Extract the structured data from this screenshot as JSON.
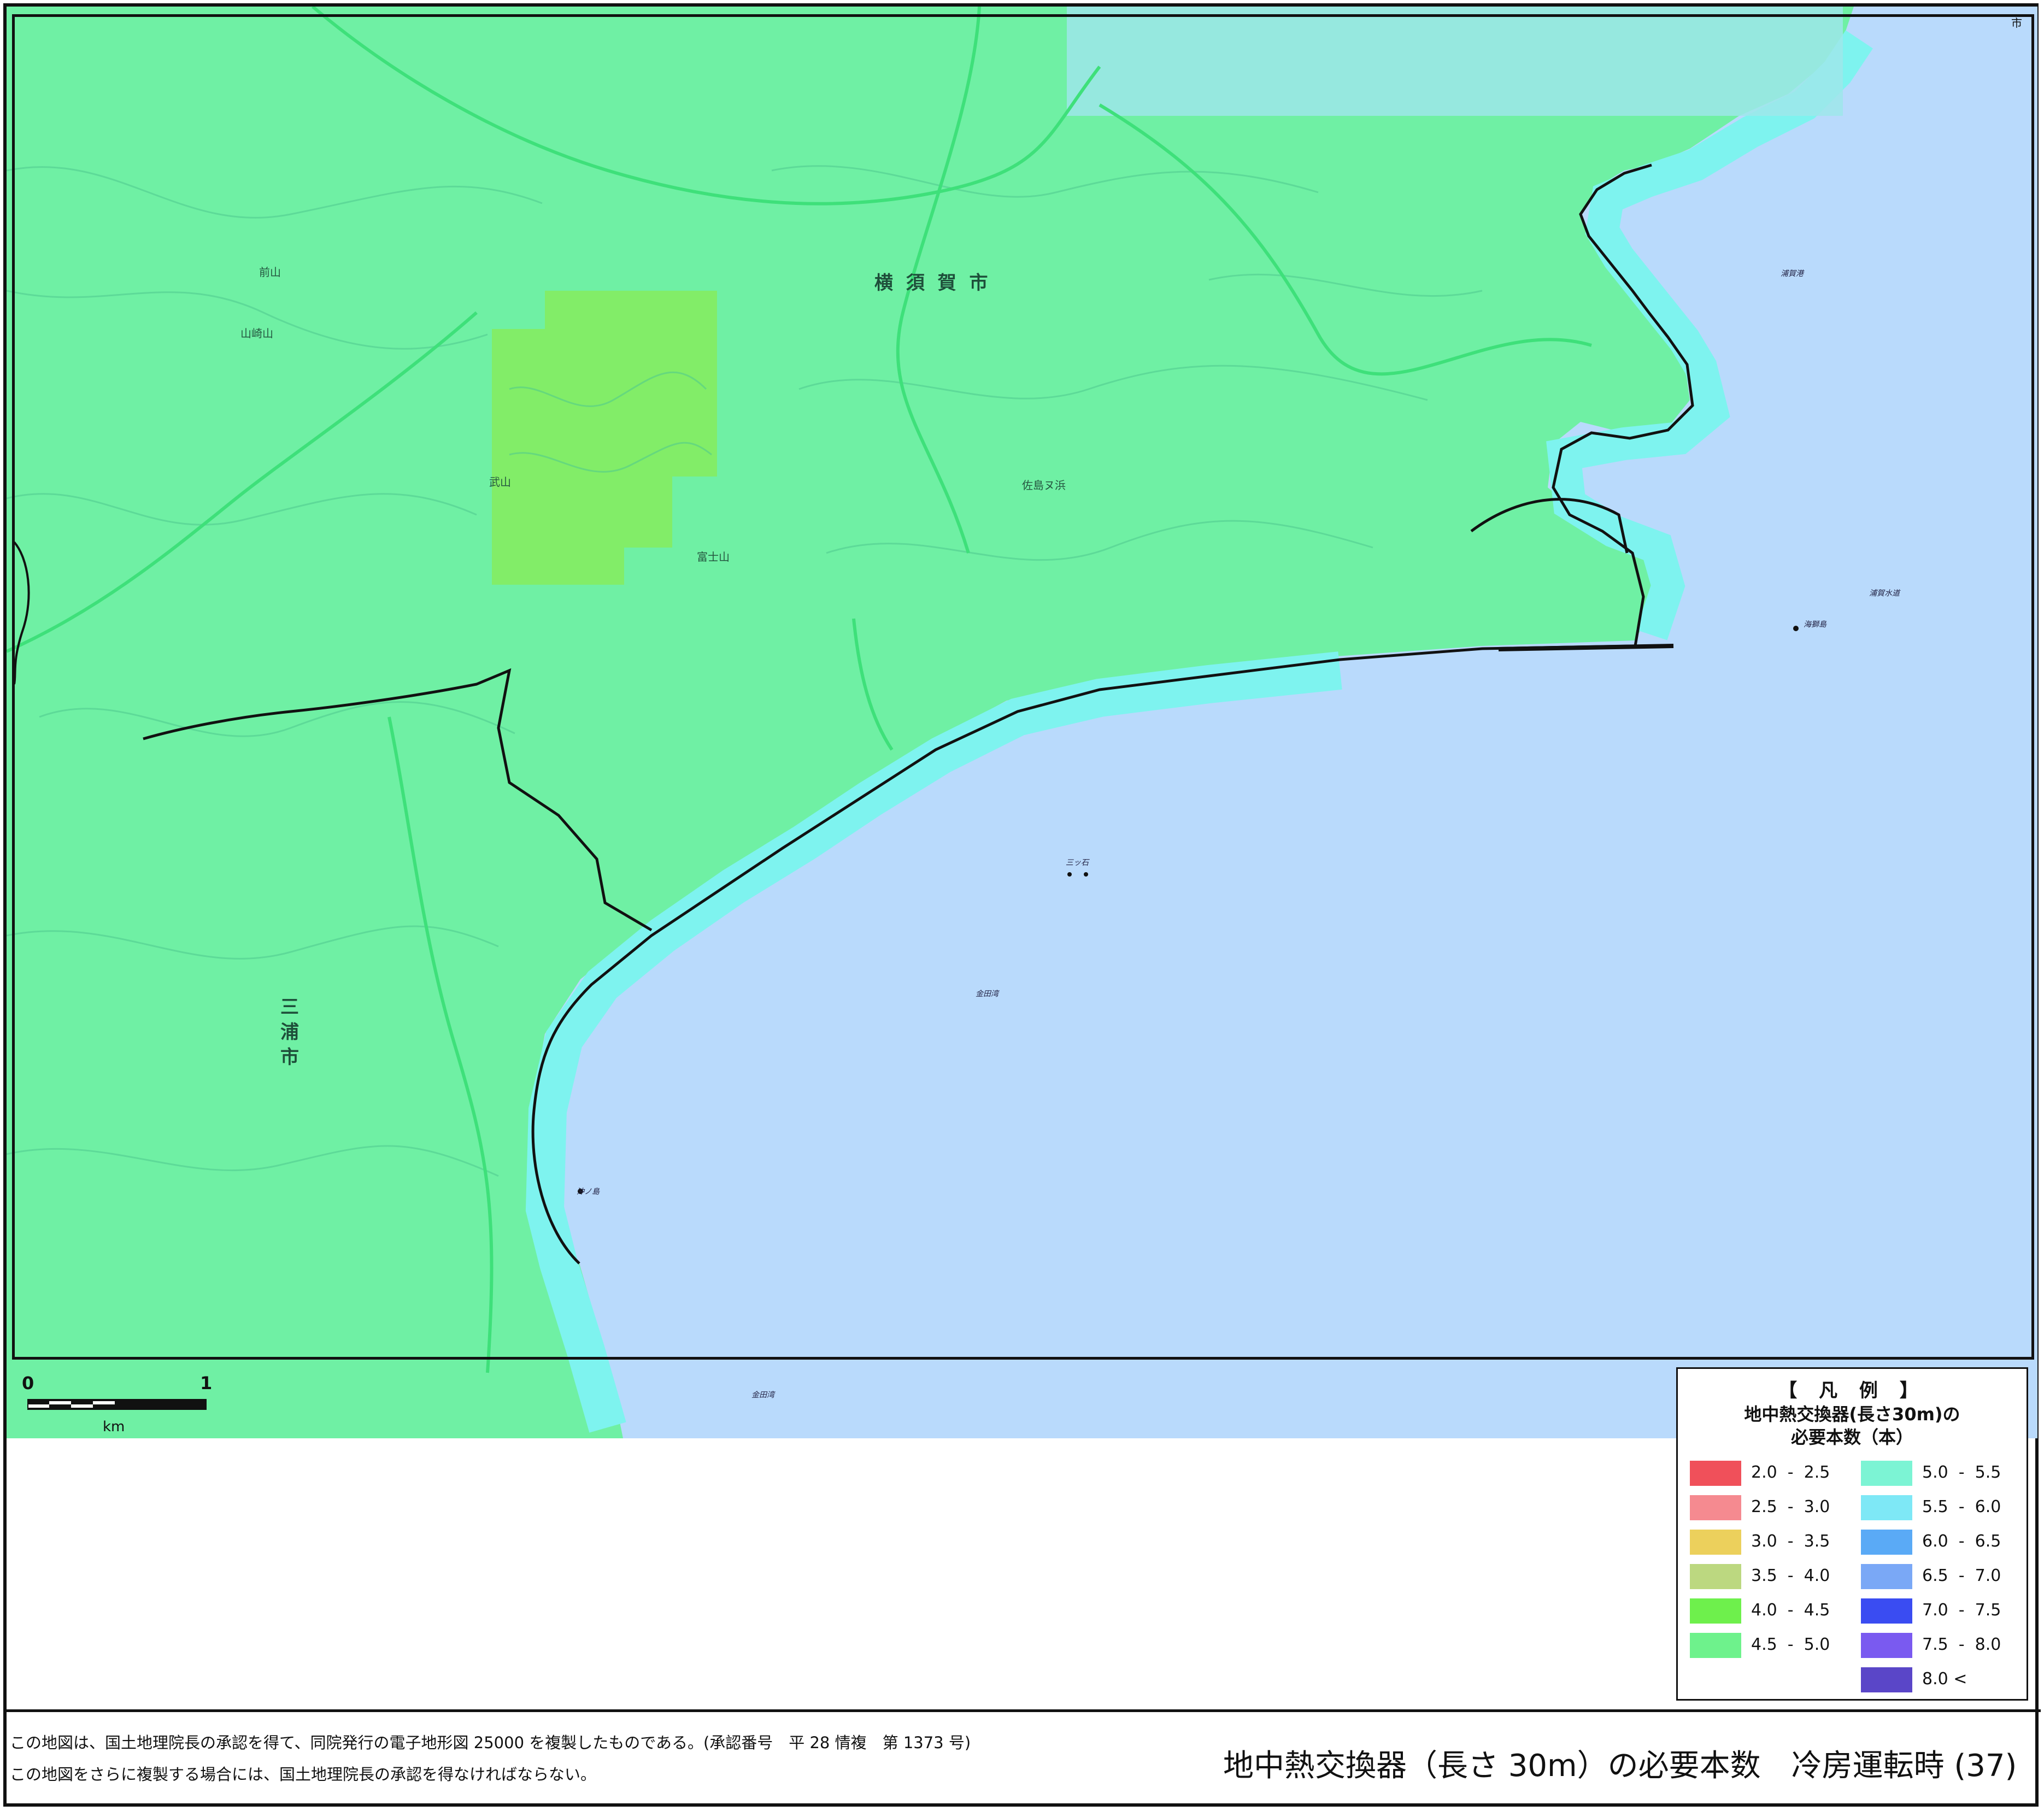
{
  "map": {
    "labels": {
      "city_yokosuka": "横 須 賀 市",
      "city_miura": "三浦市",
      "yamasaki": "山崎山",
      "maeyama": "前山",
      "takeyama": "武山",
      "fujiyama": "富士山",
      "sakaihama": "佐島ヌ浜",
      "kanadawan": "金田湾",
      "kanadawan2": "金田湾",
      "okinoshima": "沖ノ島",
      "mitsuishi": "三ッ石",
      "kaishima": "海獅島",
      "uraga": "浦賀港",
      "suido": "浦賀水道",
      "corner": "市"
    }
  },
  "scale_bar": {
    "start": "0",
    "end": "1",
    "unit": "km"
  },
  "legend": {
    "title": "【 凡 例 】",
    "subtitle1": "地中熱交換器(長さ30m)の",
    "subtitle2": "必要本数（本）",
    "items_left": [
      {
        "label": "2.0  -  2.5",
        "color": "#f0505a"
      },
      {
        "label": "2.5  -  3.0",
        "color": "#f58a90"
      },
      {
        "label": "3.0  -  3.5",
        "color": "#ecd05c"
      },
      {
        "label": "3.5  -  4.0",
        "color": "#bcd880"
      },
      {
        "label": "4.0  -  4.5",
        "color": "#6ef04c"
      },
      {
        "label": "4.5  -  5.0",
        "color": "#6ef28c"
      }
    ],
    "items_right": [
      {
        "label": "5.0  -  5.5",
        "color": "#7cf4d4"
      },
      {
        "label": "5.5  -  6.0",
        "color": "#7ee8f6"
      },
      {
        "label": "6.0  -  6.5",
        "color": "#5aaaf6"
      },
      {
        "label": "6.5  -  7.0",
        "color": "#7aa8f6"
      },
      {
        "label": "7.0  -  7.5",
        "color": "#3a4cf2"
      },
      {
        "label": "7.5  -  8.0",
        "color": "#7a5af0"
      },
      {
        "label": "8.0 <",
        "color": "#5a46c8"
      }
    ]
  },
  "footer": {
    "note1": "この地図は、国土地理院長の承認を得て、同院発行の電子地形図 25000 を複製したものである。(承認番号　平 28 情複　第 1373 号)",
    "note2": "この地図をさらに複製する場合には、国土地理院長の承認を得なければならない。",
    "title": "地中熱交換器（長さ 30m）の必要本数　冷房運転時 (37)"
  }
}
